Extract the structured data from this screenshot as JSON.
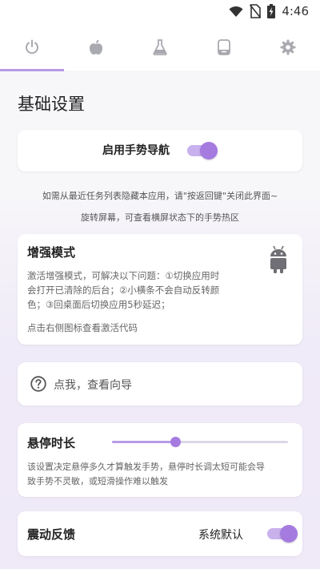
{
  "status_bar": {
    "time": "4:46",
    "icons": [
      "wifi-icon",
      "no-sim-icon",
      "battery-charging-icon"
    ]
  },
  "tabs": [
    {
      "icon": "power-icon",
      "active": true
    },
    {
      "icon": "apple-icon",
      "active": false
    },
    {
      "icon": "flask-icon",
      "active": false
    },
    {
      "icon": "phone-icon",
      "active": false
    },
    {
      "icon": "gear-icon",
      "active": false
    }
  ],
  "page_title": "基础设置",
  "gesture_card": {
    "label": "启用手势导航",
    "enabled": true
  },
  "hint": {
    "line1": "如需从最近任务列表隐藏本应用，请\"按返回键\"关闭此界面~",
    "line2": "旋转屏幕，可查看横屏状态下的手势热区"
  },
  "enhanced_card": {
    "title": "增强模式",
    "desc_line1": "激活增强模式，可解决以下问题：①切换应用时",
    "desc_line2": "会打开已清除的后台；②小横条不会自动反转颜",
    "desc_line3": "色；③回桌面后切换应用5秒延迟；",
    "note": "点击右侧图标查看激活代码",
    "icon": "android-icon"
  },
  "guide_card": {
    "icon": "help-circle-icon",
    "label": "点我，查看向导"
  },
  "hover_card": {
    "title": "悬停时长",
    "slider_value": 0.36,
    "desc_line1": "该设置决定悬停多久才算触发手势，悬停时长调太短可能会导",
    "desc_line2": "致手势不灵敏，或短滑操作难以触发"
  },
  "vibration_card": {
    "title": "震动反馈",
    "value_label": "系统默认",
    "enabled": true
  },
  "colors": {
    "accent": "#a57be0",
    "accent_light": "#c9b1ee",
    "background": "#f7f6f9"
  }
}
